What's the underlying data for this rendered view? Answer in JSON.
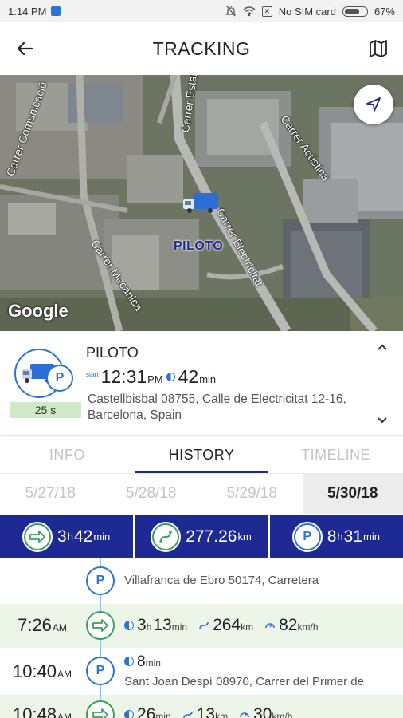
{
  "status_bar": {
    "time": "1:14 PM",
    "no_sim": "No SIM card",
    "battery": "67%"
  },
  "header": {
    "title": "TRACKING"
  },
  "map": {
    "streets": [
      "Carrer Comunicació",
      "Carrer Estany",
      "Carrer Acústica",
      "Carrer Electricitat",
      "Carrer Mecànica"
    ],
    "vehicle_label": "PILOTO",
    "attribution": "Google"
  },
  "vehicle": {
    "name": "PILOTO",
    "start_label": "start",
    "start_time": "12:31",
    "start_ampm": "PM",
    "duration_value": "42",
    "duration_unit": "min",
    "address": "Castellbisbal 08755, Calle de Electricitat 12-16, Barcelona, Spain",
    "refresh_badge": "25 s",
    "status_letter": "P"
  },
  "tabs": [
    {
      "label": "INFO",
      "active": false
    },
    {
      "label": "HISTORY",
      "active": true
    },
    {
      "label": "TIMELINE",
      "active": false
    }
  ],
  "dates": [
    {
      "label": "5/27/18",
      "selected": false
    },
    {
      "label": "5/28/18",
      "selected": false
    },
    {
      "label": "5/29/18",
      "selected": false
    },
    {
      "label": "5/30/18",
      "selected": true
    }
  ],
  "summary": {
    "driving": {
      "h": "3",
      "h_unit": "h",
      "m": "42",
      "m_unit": "min"
    },
    "distance": {
      "value": "277.26",
      "unit": "km"
    },
    "parked": {
      "h": "8",
      "h_unit": "h",
      "m": "31",
      "m_unit": "min"
    },
    "parked_letter": "P"
  },
  "history": [
    {
      "type": "stop",
      "letter": "P",
      "address": "Villafranca de Ebro 50174, Carretera"
    },
    {
      "type": "move",
      "time": "7:26",
      "ampm": "AM",
      "duration_h": "3",
      "h_unit": "h",
      "duration_m": "13",
      "m_unit": "min",
      "distance": "264",
      "distance_unit": "km",
      "speed": "82",
      "speed_unit": "km/h"
    },
    {
      "type": "stop",
      "time": "10:40",
      "ampm": "AM",
      "letter": "P",
      "duration_m": "8",
      "m_unit": "min",
      "address": "Sant Joan Despí 08970, Carrer del Primer de"
    },
    {
      "type": "move",
      "time": "10:48",
      "ampm": "AM",
      "duration_m": "26",
      "m_unit": "min",
      "distance": "13",
      "distance_unit": "km",
      "speed": "30",
      "speed_unit": "km/h"
    }
  ],
  "colors": {
    "brand_dark": "#1d2a93",
    "accent_blue": "#2a74d6",
    "green": "#3aa05a",
    "move_row": "#edf5e8",
    "badge_green": "#cfe9c7"
  }
}
